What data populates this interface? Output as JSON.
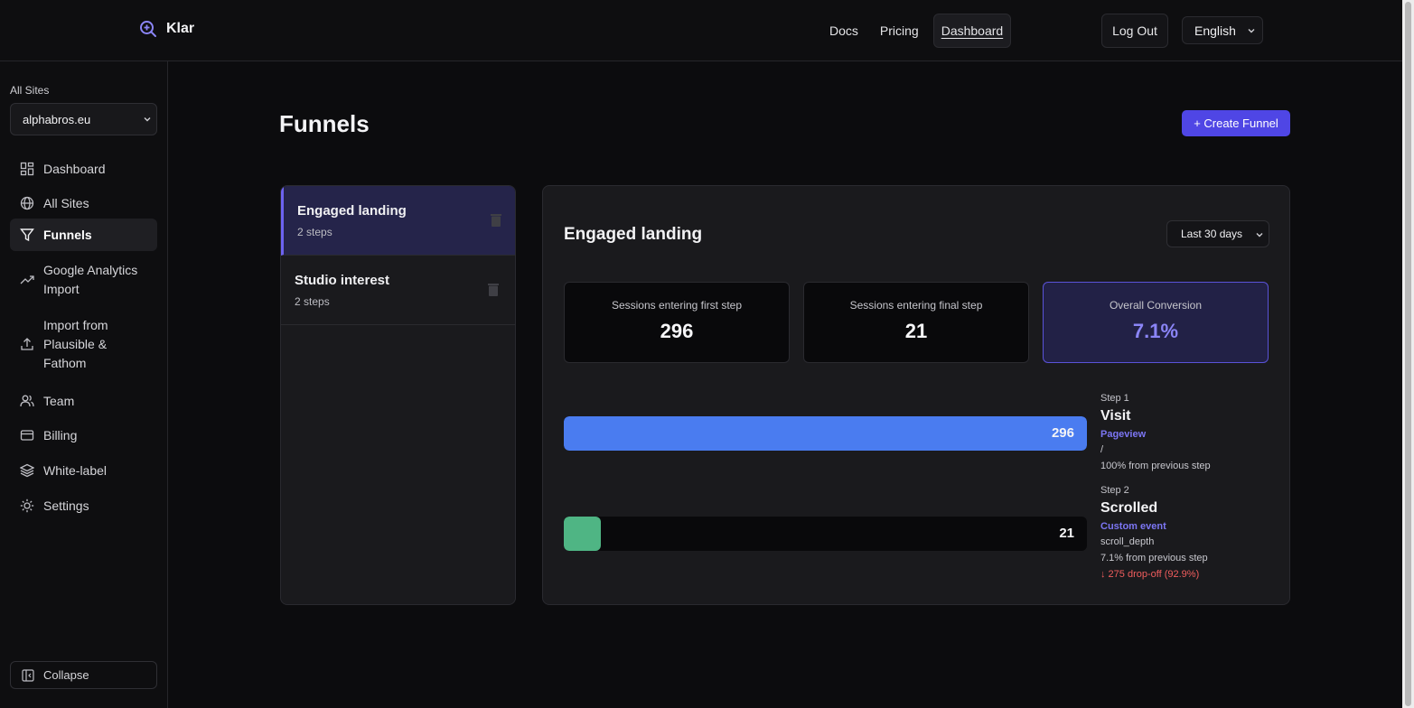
{
  "app": {
    "name": "Klar"
  },
  "nav": {
    "docs": "Docs",
    "pricing": "Pricing",
    "dashboard": "Dashboard"
  },
  "header": {
    "logout": "Log Out",
    "language": "English"
  },
  "sidebar": {
    "all_sites_label": "All Sites",
    "site": "alphabros.eu",
    "items": [
      {
        "label": "Dashboard",
        "icon": "grid-icon"
      },
      {
        "label": "All Sites",
        "icon": "globe-icon"
      },
      {
        "label": "Funnels",
        "icon": "filter-icon",
        "active": true
      },
      {
        "label": "Google Analytics Import",
        "icon": "trending-up-icon"
      },
      {
        "label": "Import from Plausible & Fathom",
        "icon": "upload-icon"
      },
      {
        "label": "Team",
        "icon": "users-icon"
      },
      {
        "label": "Billing",
        "icon": "credit-card-icon"
      },
      {
        "label": "White-label",
        "icon": "layers-icon"
      },
      {
        "label": "Settings",
        "icon": "sun-gear-icon"
      }
    ],
    "collapse": "Collapse"
  },
  "main": {
    "title": "Funnels",
    "create_button": "+ Create Funnel",
    "funnels": [
      {
        "name": "Engaged landing",
        "steps": "2 steps",
        "active": true
      },
      {
        "name": "Studio interest",
        "steps": "2 steps"
      }
    ],
    "detail": {
      "title": "Engaged landing",
      "range": "Last 30 days",
      "stats": [
        {
          "label": "Sessions entering first step",
          "value": "296"
        },
        {
          "label": "Sessions entering final step",
          "value": "21"
        },
        {
          "label": "Overall Conversion",
          "value": "7.1%"
        }
      ],
      "steps": [
        {
          "num": "Step 1",
          "name": "Visit",
          "type": "Pageview",
          "target": "/",
          "from_prev": "100% from previous step",
          "drop": "",
          "value": "296",
          "fraction": 1.0,
          "color": "#4a7cf0"
        },
        {
          "num": "Step 2",
          "name": "Scrolled",
          "type": "Custom event",
          "target": "scroll_depth",
          "from_prev": "7.1% from previous step",
          "drop": "↓ 275 drop-off (92.9%)",
          "value": "21",
          "fraction": 0.071,
          "color": "#4fb584"
        }
      ]
    }
  }
}
